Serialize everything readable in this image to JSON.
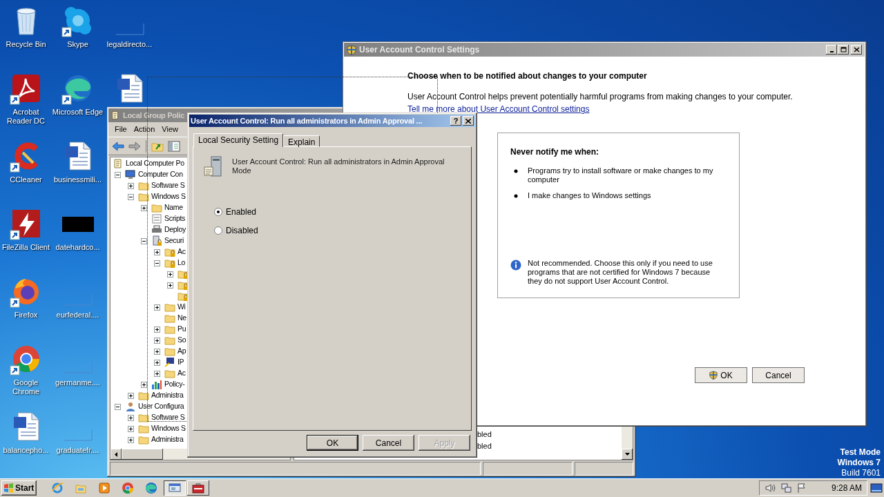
{
  "desktop_icons": [
    {
      "label": "Recycle Bin",
      "kind": "recycle-bin",
      "shortcut": false
    },
    {
      "label": "Acrobat Reader DC",
      "kind": "acrobat",
      "shortcut": true
    },
    {
      "label": "CCleaner",
      "kind": "ccleaner",
      "shortcut": true
    },
    {
      "label": "FileZilla Client",
      "kind": "filezilla",
      "shortcut": true
    },
    {
      "label": "Firefox",
      "kind": "firefox",
      "shortcut": true
    },
    {
      "label": "Google Chrome",
      "kind": "chrome",
      "shortcut": true
    },
    {
      "label": "balancepho...",
      "kind": "word",
      "shortcut": false
    },
    {
      "label": "Skype",
      "kind": "skype",
      "shortcut": true
    },
    {
      "label": "Microsoft Edge",
      "kind": "edge",
      "shortcut": true
    },
    {
      "label": "businessmili...",
      "kind": "word",
      "shortcut": false
    },
    {
      "label": "datehardco...",
      "kind": "black",
      "shortcut": false
    },
    {
      "label": "eurfederal....",
      "kind": "blank",
      "shortcut": false
    },
    {
      "label": "germanme....",
      "kind": "blank",
      "shortcut": false
    },
    {
      "label": "graduatefr....",
      "kind": "blank",
      "shortcut": false
    },
    {
      "label": "legaldirecto...",
      "kind": "blank",
      "shortcut": false
    },
    {
      "kind": "word",
      "shortcut": false
    }
  ],
  "os_info": [
    {
      "text": "Test Mode",
      "bold": true
    },
    {
      "text": "Windows 7",
      "bold": true
    },
    {
      "text": "Build 7601",
      "bold": false
    }
  ],
  "group_policy_window": {
    "title": "Local Group Polic",
    "menu": [
      "File",
      "Action",
      "View"
    ],
    "tree": [
      {
        "label": "Local Computer Po",
        "kind": "policy",
        "children": [
          {
            "label": "Computer Con",
            "kind": "computer",
            "expanded": true,
            "children": [
              {
                "label": "Software S",
                "kind": "folder",
                "expanded": false
              },
              {
                "label": "Windows S",
                "kind": "folder",
                "expanded": true,
                "children": [
                  {
                    "label": "Name",
                    "kind": "folder",
                    "expanded": false
                  },
                  {
                    "label": "Scripts",
                    "kind": "script"
                  },
                  {
                    "label": "Deploy",
                    "kind": "printer"
                  },
                  {
                    "label": "Securi",
                    "kind": "security",
                    "expanded": true,
                    "children": [
                      {
                        "label": "Ac",
                        "kind": "folder-lock",
                        "expanded": false
                      },
                      {
                        "label": "Lo",
                        "kind": "folder-lock",
                        "expanded": true,
                        "children": [
                          {
                            "kind": "folder-lock",
                            "expanded": false
                          },
                          {
                            "kind": "folder-lock",
                            "expanded": false
                          },
                          {
                            "kind": "folder-lock"
                          }
                        ]
                      },
                      {
                        "label": "Wi",
                        "kind": "folder",
                        "expanded": false
                      },
                      {
                        "label": "Ne",
                        "kind": "folder"
                      },
                      {
                        "label": "Pu",
                        "kind": "folder",
                        "expanded": false
                      },
                      {
                        "label": "So",
                        "kind": "folder",
                        "expanded": false
                      },
                      {
                        "label": "Ap",
                        "kind": "folder",
                        "expanded": false
                      },
                      {
                        "label": "IP",
                        "kind": "network",
                        "expanded": false
                      },
                      {
                        "label": "Ac",
                        "kind": "folder",
                        "expanded": false
                      }
                    ]
                  },
                  {
                    "label": "Policy-",
                    "kind": "chart",
                    "expanded": false
                  }
                ]
              },
              {
                "label": "Administra",
                "kind": "folder",
                "expanded": false
              }
            ]
          },
          {
            "label": "User Configura",
            "kind": "user",
            "expanded": true,
            "children": [
              {
                "label": "Software S",
                "kind": "folder",
                "expanded": false
              },
              {
                "label": "Windows S",
                "kind": "folder",
                "expanded": false
              },
              {
                "label": "Administra",
                "kind": "folder",
                "expanded": false
              }
            ]
          }
        ]
      }
    ],
    "list_rows": [
      "bled",
      "bled"
    ]
  },
  "uac_settings_window": {
    "title": "User Account Control Settings",
    "heading": "Choose when to be notified about changes to your computer",
    "description": "User Account Control helps prevent potentially harmful programs from making changes to your computer.",
    "link": "Tell me more about User Account Control settings",
    "panel": {
      "heading": "Never notify me when:",
      "bullets": [
        "Programs try to install software or make changes to my computer",
        "I make changes to Windows settings"
      ],
      "note": "Not recommended. Choose this only if you need to use programs that are not certified for Windows 7 because they do not support User Account Control."
    },
    "buttons": [
      {
        "label": "OK",
        "shield": true
      },
      {
        "label": "Cancel",
        "shield": false
      }
    ]
  },
  "policy_dialog": {
    "title": "User Account Control: Run all administrators in Admin Approval ...",
    "help": "?",
    "tabs": [
      {
        "label": "Local Security Setting",
        "selected": true
      },
      {
        "label": "Explain",
        "selected": false
      }
    ],
    "policy_name": "User Account Control: Run all administrators in Admin Approval Mode",
    "options": [
      {
        "label": "Enabled",
        "selected": true
      },
      {
        "label": "Disabled",
        "selected": false
      }
    ],
    "buttons": [
      {
        "label": "OK",
        "default": true,
        "disabled": false
      },
      {
        "label": "Cancel",
        "default": false,
        "disabled": false
      },
      {
        "label": "Apply",
        "default": false,
        "disabled": true
      }
    ]
  },
  "taskbar": {
    "start": "Start",
    "apps": [
      {
        "kind": "ie",
        "running": false
      },
      {
        "kind": "explorer",
        "running": false
      },
      {
        "kind": "media",
        "running": false
      },
      {
        "kind": "chrome",
        "running": false
      },
      {
        "kind": "edge",
        "running": false
      },
      {
        "kind": "gpedit",
        "running": true,
        "active": true
      },
      {
        "kind": "security",
        "running": true,
        "active": false
      }
    ],
    "clock": "9:28 AM"
  }
}
